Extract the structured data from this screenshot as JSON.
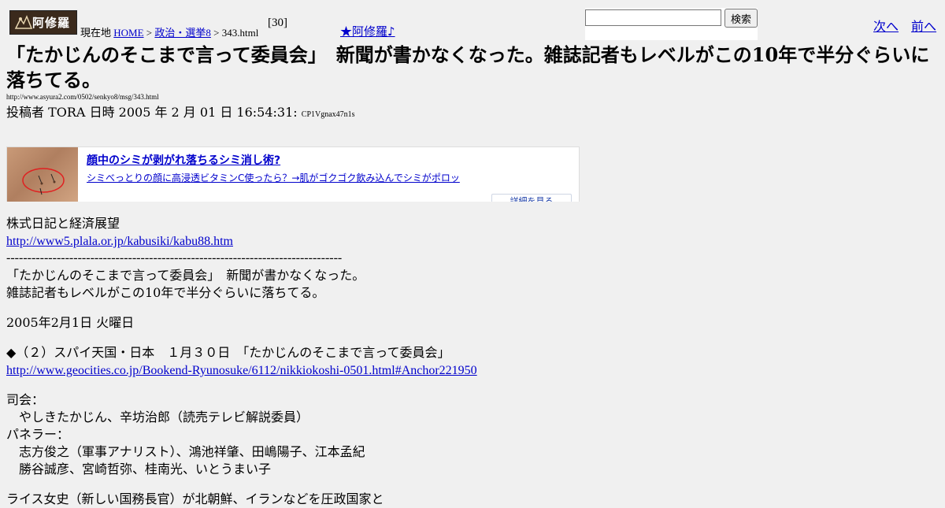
{
  "header": {
    "logo_text": "阿修羅",
    "breadcrumb": {
      "prefix": "現在地",
      "home": "HOME",
      "sep1": ">",
      "category": "政治・選挙8",
      "sep2": ">",
      "page": "343.html"
    },
    "count": "[30]",
    "star_link": "★阿修羅♪",
    "search": {
      "value": "",
      "button": "検索"
    },
    "next": "次へ",
    "prev": "前へ"
  },
  "article": {
    "title": "「たかじんのそこまで言って委員会」　新聞が書かなくなった。雑誌記者もレベルがこの10年で半分ぐらいに落ちてる。",
    "url": "http://www.asyura2.com/0502/senkyo8/msg/343.html",
    "meta": "投稿者 TORA 日時 2005 年 2 月 01 日 16:54:31:",
    "meta_code": "CP1Vgnax47n1s"
  },
  "ad": {
    "headline": "顔中のシミが剥がれ落ちるシミ消し術?",
    "subline": "シミべっとりの顔に高浸透ビタミンC使ったら？→肌がゴクゴク飲み込んでシミがポロッ",
    "more": "詳細を見る"
  },
  "body": {
    "l1": "株式日記と経済展望",
    "link1": "http://www5.plala.or.jp/kabusiki/kabu88.htm",
    "dashes": "--------------------------------------------------------------------------------",
    "l2": "「たかじんのそこまで言って委員会」　新聞が書かなくなった。",
    "l3": "雑誌記者もレベルがこの10年で半分ぐらいに落ちてる。",
    "l4": "2005年2月1日 火曜日",
    "l5": "◆（２）スパイ天国・日本　１月３０日　「たかじんのそこまで言って委員会」",
    "link2": "http://www.geocities.co.jp/Bookend-Ryunosuke/6112/nikkiokoshi-0501.html#Anchor221950",
    "l6": "司会：",
    "l7": "　やしきたかじん、辛坊治郎（読売テレビ解説委員）",
    "l8": "パネラー：",
    "l9": "　志方俊之（軍事アナリスト）、鴻池祥肇、田嶋陽子、江本孟紀",
    "l10": "　勝谷誠彦、宮崎哲弥、桂南光、いとうまい子",
    "l11": "ライス女史（新しい国務長官）が北朝鮮、イランなどを圧政国家と"
  }
}
